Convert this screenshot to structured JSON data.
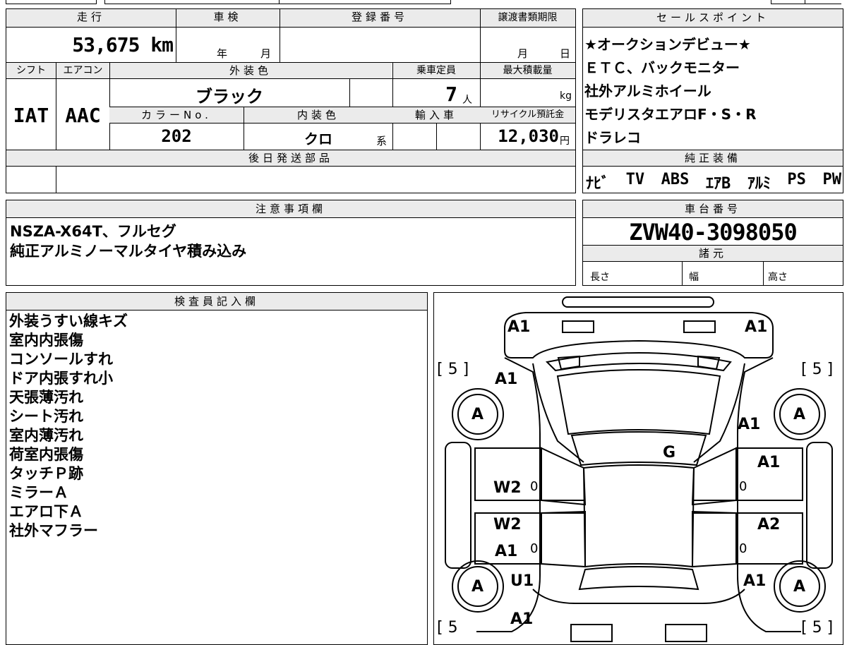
{
  "top": {
    "mileage_label": "走行",
    "mileage_value": "53,675 km",
    "inspection_label": "車検",
    "inspection_year": "年",
    "inspection_month": "月",
    "registration_label": "登録番号",
    "transfer_label": "譲渡書類期限",
    "transfer_month": "月",
    "transfer_day": "日",
    "shift_label": "シフト",
    "shift_value": "IAT",
    "aircon_label": "エアコン",
    "aircon_value": "AAC",
    "exterior_color_label": "外装色",
    "exterior_color_value": "ブラック",
    "capacity_label": "乗車定員",
    "capacity_value": "7",
    "capacity_unit": "人",
    "max_load_label": "最大積載量",
    "max_load_unit": "kg",
    "color_no_label": "カラーNo.",
    "color_no_value": "202",
    "interior_color_label": "内装色",
    "interior_color_value": "クロ",
    "interior_color_suffix": "系",
    "import_label": "輸入車",
    "recycle_label": "リサイクル預託金",
    "recycle_value": "12,030",
    "recycle_unit": "円",
    "later_parts_label": "後日発送部品"
  },
  "sales": {
    "title": "セールスポイント",
    "lines": [
      "★オークションデビュー★",
      "ＥＴＣ、バックモニター",
      "社外アルミホイール",
      "モデリスタエアロF・S・R",
      "ドラレコ"
    ],
    "genuine_title": "純正装備",
    "genuine_items": [
      "ﾅﾋﾞ",
      "TV",
      "ABS",
      "ｴｱB",
      "ｱﾙﾐ",
      "PS",
      "PW"
    ]
  },
  "notes": {
    "title": "注意事項欄",
    "lines": [
      "NSZA-X64T、フルセグ",
      "純正アルミノーマルタイヤ積み込み"
    ]
  },
  "chassis": {
    "title": "車台番号",
    "value": "ZVW40-3098050",
    "spec_title": "諸元",
    "length_label": "長さ",
    "width_label": "幅",
    "height_label": "高さ"
  },
  "inspector": {
    "title": "検査員記入欄",
    "lines": [
      "外装うすい線キズ",
      "室内内張傷",
      "コンソールすれ",
      "ドア内張すれ小",
      "天張薄汚れ",
      "シート汚れ",
      "室内薄汚れ",
      "荷室内張傷",
      "タッチＰ跡",
      "ミラーＡ",
      "エアロ下Ａ",
      "社外マフラー"
    ]
  },
  "diagram": {
    "front_left": "A1",
    "front_right": "A1",
    "bracket_tl": "[ 5 ]",
    "bracket_tr": "[ 5 ]",
    "bracket_bl": "[ 5",
    "bracket_br": "[ 5 ]",
    "fender_left": "A1",
    "fender_right": "A1",
    "tire_fl": "A",
    "tire_fr": "A",
    "tire_rl": "A",
    "tire_rr": "A",
    "windshield": "G",
    "front_door_right": "A1",
    "front_door_left": "W2",
    "front_door_left_zero": "0",
    "front_door_right_zero": "0",
    "rear_door_left_top": "W2",
    "rear_door_left_bottom": "A1",
    "rear_door_left_zero": "0",
    "rear_door_right": "A2",
    "rear_door_right_zero": "0",
    "rear_left_u": "U1",
    "rear_right": "A1",
    "bottom_left": "A1"
  }
}
